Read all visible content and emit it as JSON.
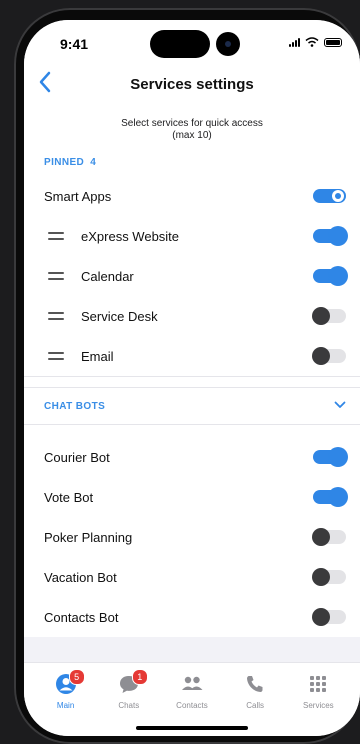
{
  "status_bar": {
    "time": "9:41"
  },
  "header": {
    "title": "Services settings",
    "back_icon": "chevron-left-icon"
  },
  "hint": {
    "line1": "Select services for quick access",
    "line2": "(max 10)"
  },
  "pinned": {
    "label": "PINNED",
    "count": "4",
    "items": [
      {
        "label": "Smart Apps",
        "enabled": true,
        "locked": true,
        "draggable": false
      },
      {
        "label": "eXpress Website",
        "enabled": true,
        "draggable": true
      },
      {
        "label": "Calendar",
        "enabled": true,
        "draggable": true
      },
      {
        "label": "Service Desk",
        "enabled": false,
        "draggable": true
      },
      {
        "label": "Email",
        "enabled": false,
        "draggable": true
      }
    ]
  },
  "chat_bots": {
    "label": "CHAT BOTS",
    "expanded": true,
    "items": [
      {
        "label": "Courier Bot",
        "enabled": true
      },
      {
        "label": "Vote Bot",
        "enabled": true
      },
      {
        "label": "Poker Planning",
        "enabled": false
      },
      {
        "label": "Vacation Bot",
        "enabled": false
      },
      {
        "label": "Contacts Bot",
        "enabled": false
      }
    ]
  },
  "tabbar": {
    "tabs": [
      {
        "label": "Main",
        "icon": "user-circle-icon",
        "badge": "5",
        "active": true
      },
      {
        "label": "Chats",
        "icon": "chat-bubble-icon",
        "badge": "1",
        "active": false
      },
      {
        "label": "Contacts",
        "icon": "contacts-icon",
        "active": false
      },
      {
        "label": "Calls",
        "icon": "phone-icon",
        "active": false
      },
      {
        "label": "Services",
        "icon": "grid-icon",
        "active": false
      }
    ]
  },
  "colors": {
    "accent": "#2f86e6",
    "badge": "#e53935",
    "section_header": "#3a8ee6"
  }
}
